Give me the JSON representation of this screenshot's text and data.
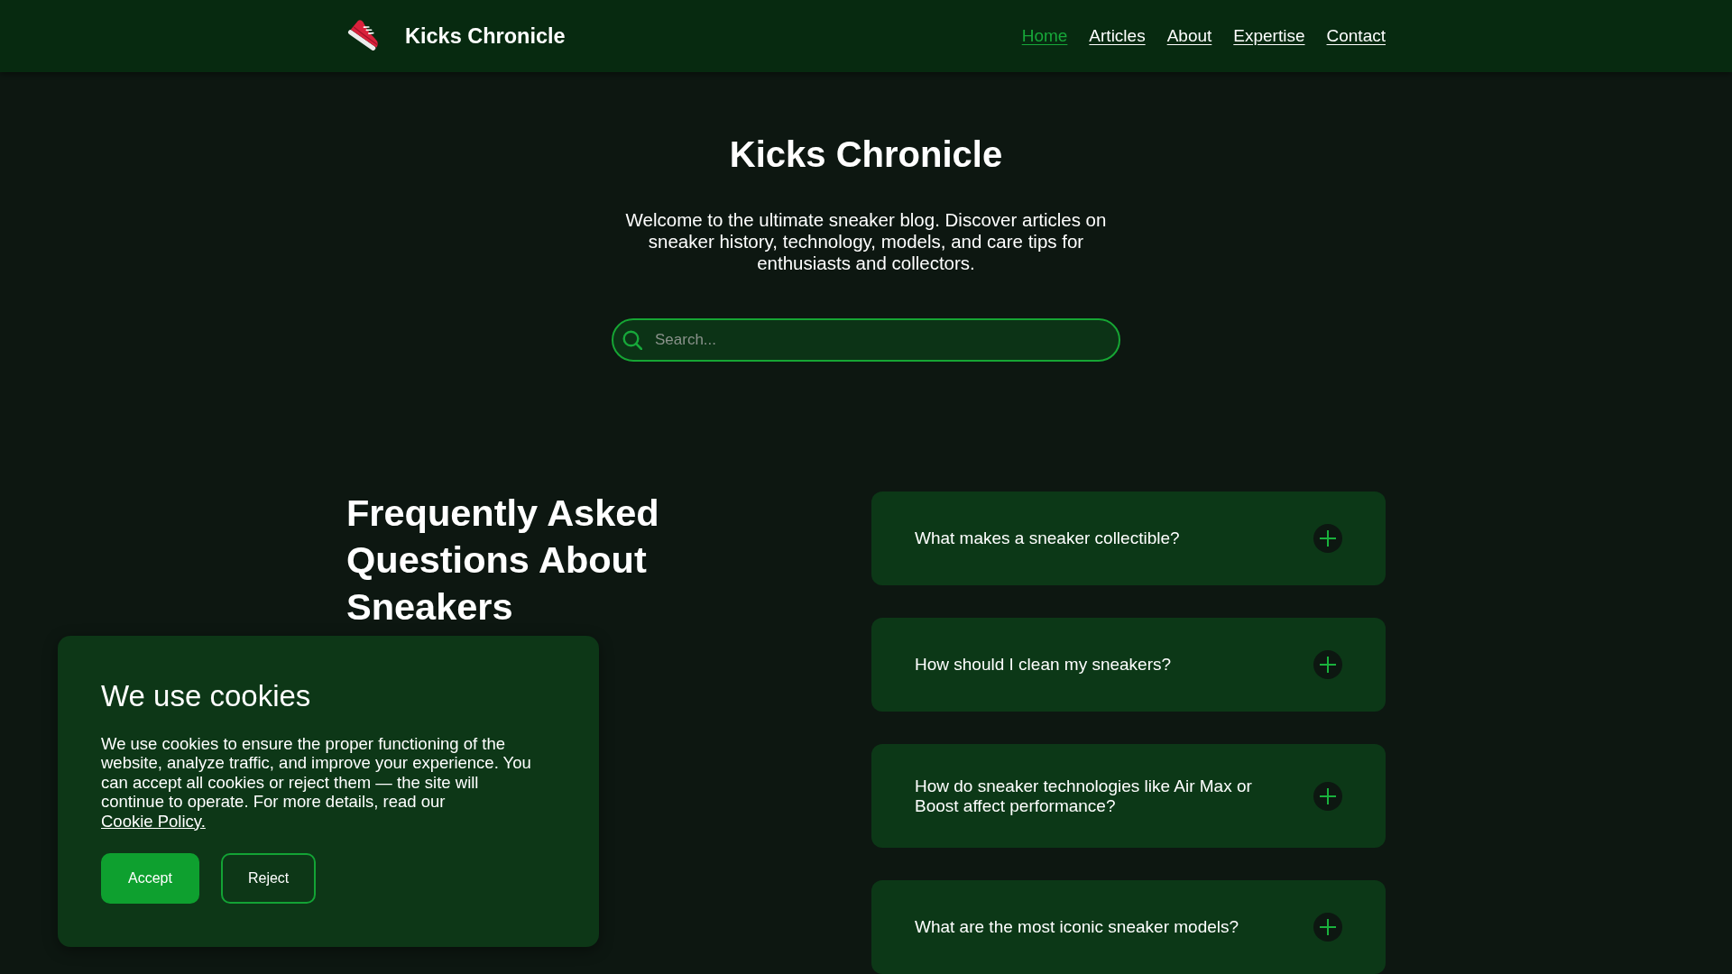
{
  "header": {
    "logo_text": "Kicks Chronicle",
    "nav": [
      {
        "label": "Home",
        "selected": true
      },
      {
        "label": "Articles",
        "selected": false
      },
      {
        "label": "About",
        "selected": false
      },
      {
        "label": "Expertise",
        "selected": false
      },
      {
        "label": "Contact",
        "selected": false
      }
    ]
  },
  "hero": {
    "title": "Kicks Chronicle",
    "description": "Welcome to the ultimate sneaker blog. Discover articles on sneaker history, technology, models, and care tips for enthusiasts and collectors.",
    "search": {
      "placeholder": "Search..."
    }
  },
  "faq": {
    "title": "Frequently Asked Questions About Sneakers",
    "items": [
      {
        "question": "What makes a sneaker collectible?",
        "expanded": false
      },
      {
        "question": "How should I clean my sneakers?",
        "expanded": false
      },
      {
        "question": "How do sneaker technologies like Air Max or Boost affect performance?",
        "expanded": false
      },
      {
        "question": "What are the most iconic sneaker models?",
        "expanded": false
      }
    ]
  },
  "cookie_banner": {
    "title": "We use cookies",
    "text": "We use cookies to ensure the proper functioning of the website, analyze traffic, and improve your experience. You can accept all cookies or reject them — the site will continue to operate. For more details, read our",
    "link": "Cookie Policy.",
    "buttons": [
      {
        "label": "Accept",
        "kind": "primary"
      },
      {
        "label": "Reject",
        "kind": "secondary"
      }
    ]
  }
}
